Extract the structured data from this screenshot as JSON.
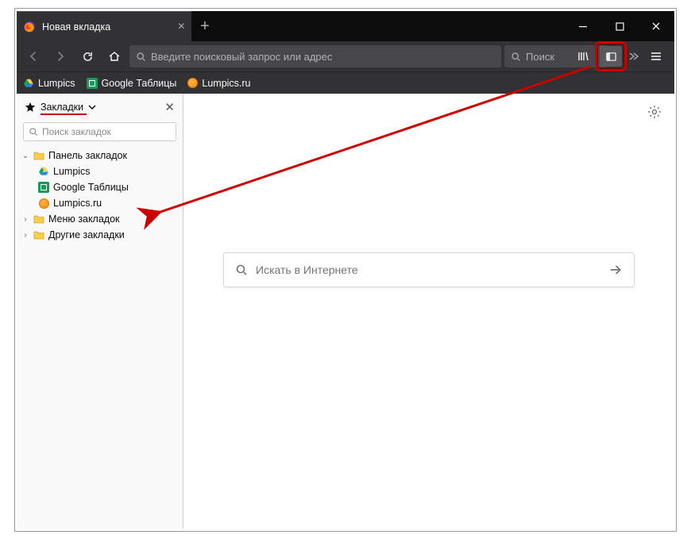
{
  "tab": {
    "title": "Новая вкладка"
  },
  "urlbar": {
    "placeholder": "Введите поисковый запрос или адрес"
  },
  "searchbar": {
    "placeholder": "Поиск"
  },
  "bookmarks_bar": {
    "items": [
      {
        "label": "Lumpics"
      },
      {
        "label": "Google Таблицы"
      },
      {
        "label": "Lumpics.ru"
      }
    ]
  },
  "sidebar": {
    "title": "Закладки",
    "search_placeholder": "Поиск закладок",
    "tree": {
      "toolbar_folder": "Панель закладок",
      "items": [
        {
          "label": "Lumpics"
        },
        {
          "label": "Google Таблицы"
        },
        {
          "label": "Lumpics.ru"
        }
      ],
      "menu_folder": "Меню закладок",
      "other_folder": "Другие закладки"
    }
  },
  "newtab": {
    "search_placeholder": "Искать в Интернете"
  }
}
